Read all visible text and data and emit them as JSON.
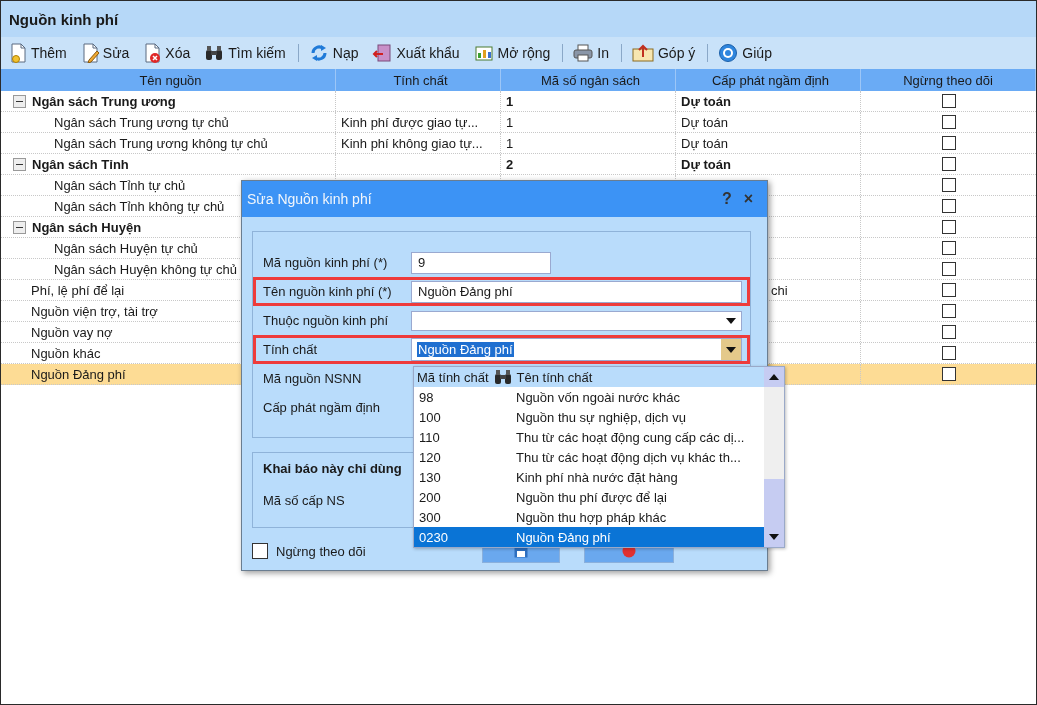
{
  "window": {
    "title": "Nguồn kinh phí"
  },
  "toolbar": [
    {
      "kind": "button",
      "label": "Thêm"
    },
    {
      "kind": "button",
      "label": "Sửa"
    },
    {
      "kind": "button",
      "label": "Xóa"
    },
    {
      "kind": "button",
      "label": "Tìm kiếm"
    },
    {
      "kind": "separator"
    },
    {
      "kind": "button",
      "label": "Nạp"
    },
    {
      "kind": "button",
      "label": "Xuất khẩu"
    },
    {
      "kind": "button",
      "label": "Mở rộng"
    },
    {
      "kind": "separator"
    },
    {
      "kind": "button",
      "label": "In"
    },
    {
      "kind": "separator"
    },
    {
      "kind": "button",
      "label": "Góp ý"
    },
    {
      "kind": "separator"
    },
    {
      "kind": "button",
      "label": "Giúp"
    }
  ],
  "table": {
    "columns": [
      "Tên nguồn",
      "Tính chất",
      "Mã số ngân sách",
      "Cấp phát ngầm định",
      "Ngừng theo dõi"
    ],
    "rows": [
      {
        "name": "Ngân sách Trung ương",
        "expanded": true,
        "budget_code": "1",
        "allocation": "Dự toán",
        "stop_tracking": false,
        "selected": false,
        "children": [
          {
            "name": "Ngân sách Trung ương tự chủ",
            "property": "Kinh phí được giao tự...",
            "budget_code": "1",
            "allocation": "Dự toán",
            "stop_tracking": false,
            "selected": false
          },
          {
            "name": "Ngân sách Trung ương không tự chủ",
            "property": "Kinh phí không giao tự...",
            "budget_code": "1",
            "allocation": "Dự toán",
            "stop_tracking": false,
            "selected": false
          }
        ]
      },
      {
        "name": "Ngân sách Tỉnh",
        "expanded": true,
        "budget_code": "2",
        "allocation": "Dự toán",
        "stop_tracking": false,
        "selected": false,
        "children": [
          {
            "name": "Ngân sách Tỉnh tự chủ",
            "stop_tracking": false,
            "selected": false
          },
          {
            "name": "Ngân sách Tỉnh không tự chủ",
            "stop_tracking": false,
            "selected": false
          }
        ]
      },
      {
        "name": "Ngân sách Huyện",
        "expanded": true,
        "stop_tracking": false,
        "selected": false,
        "children": [
          {
            "name": "Ngân sách Huyện tự chủ",
            "stop_tracking": false,
            "selected": false
          },
          {
            "name": "Ngân sách Huyện không tự chủ",
            "stop_tracking": false,
            "selected": false
          }
        ]
      },
      {
        "name": "Phí, lệ phí để lại",
        "allocation": "chi",
        "stop_tracking": false,
        "selected": false
      },
      {
        "name": "Nguồn viện trợ, tài trợ",
        "stop_tracking": false,
        "selected": false
      },
      {
        "name": "Nguồn vay nợ",
        "stop_tracking": false,
        "selected": false
      },
      {
        "name": "Nguồn khác",
        "stop_tracking": false,
        "selected": false
      },
      {
        "name": "Nguồn Đảng phí",
        "stop_tracking": false,
        "selected": true
      }
    ]
  },
  "dialog": {
    "title": "Sửa Nguồn kinh phí",
    "help": "?",
    "close": "×",
    "fields": [
      {
        "kind": "short_text",
        "label": "Mã nguồn kinh phí (*)",
        "value": "9",
        "highlighted": false
      },
      {
        "kind": "text",
        "label": "Tên nguồn kinh phí (*)",
        "value": "Nguồn Đảng phí",
        "highlighted": true
      },
      {
        "kind": "combo",
        "label": "Thuộc nguồn kinh phí",
        "highlighted": false
      },
      {
        "kind": "combo_open",
        "label": "Tính chất",
        "value": "Nguồn Đảng phí",
        "text_selected": true,
        "highlighted": true
      },
      {
        "kind": "covered",
        "label": "Mã nguồn NSNN",
        "highlighted": false
      },
      {
        "kind": "covered",
        "label": "Cấp phát ngầm định",
        "highlighted": false
      }
    ],
    "section": {
      "title": "Khai báo này chỉ dùng",
      "fields": [
        {
          "label": "Mã số cấp NS"
        }
      ]
    },
    "checkbox": {
      "label": "Ngừng theo dõi",
      "checked": false
    },
    "buttons": [
      {
        "kind": "save"
      },
      {
        "kind": "cancel"
      }
    ]
  },
  "dropdown": {
    "columns": [
      "Mã tính chất",
      "Tên tính chất"
    ],
    "rows": [
      {
        "code": "98",
        "name": "Nguồn vốn ngoài nước khác",
        "selected": false
      },
      {
        "code": "100",
        "name": "Nguồn thu sự nghiệp, dịch vụ",
        "selected": false
      },
      {
        "code": "110",
        "name": "Thu từ các hoạt động cung cấp các dị...",
        "selected": false
      },
      {
        "code": "120",
        "name": "Thu từ các hoạt động dịch vụ khác th...",
        "selected": false
      },
      {
        "code": "130",
        "name": "Kinh phí nhà nước đặt hàng",
        "selected": false
      },
      {
        "code": "200",
        "name": "Nguồn thu phí được để lại",
        "selected": false
      },
      {
        "code": "300",
        "name": "Nguồn thu hợp pháp khác",
        "selected": false
      },
      {
        "code": "0230",
        "name": "Nguồn Đảng phí",
        "selected": true
      }
    ]
  }
}
